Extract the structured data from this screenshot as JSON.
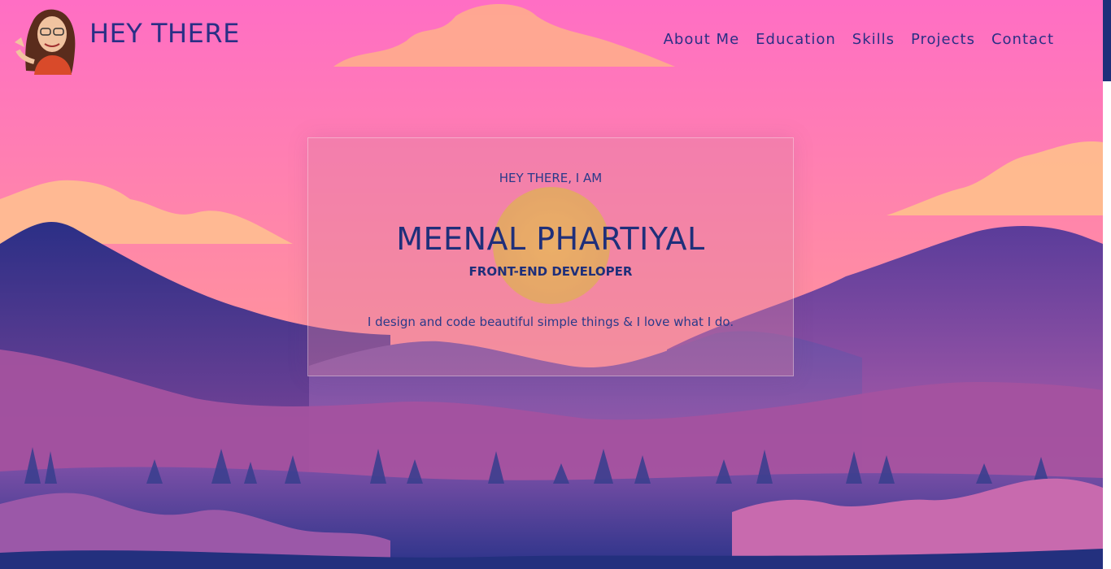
{
  "header": {
    "brand": "HEY THERE",
    "avatar": "bitmoji-avatar-waving",
    "nav": [
      "About Me",
      "Education",
      "Skills",
      "Projects",
      "Contact"
    ]
  },
  "hero": {
    "greeting": "HEY THERE, I AM",
    "name": "MEENAL PHARTIYAL",
    "role": "FRONT-END DEVELOPER",
    "tagline": "I design and code beautiful simple things & I love what I do."
  },
  "colors": {
    "sky_top": "#ff6ec4",
    "sky_bottom": "#ffb38a",
    "text_primary": "#1f2f7a",
    "mountain_dark": "#2b3a8c"
  }
}
